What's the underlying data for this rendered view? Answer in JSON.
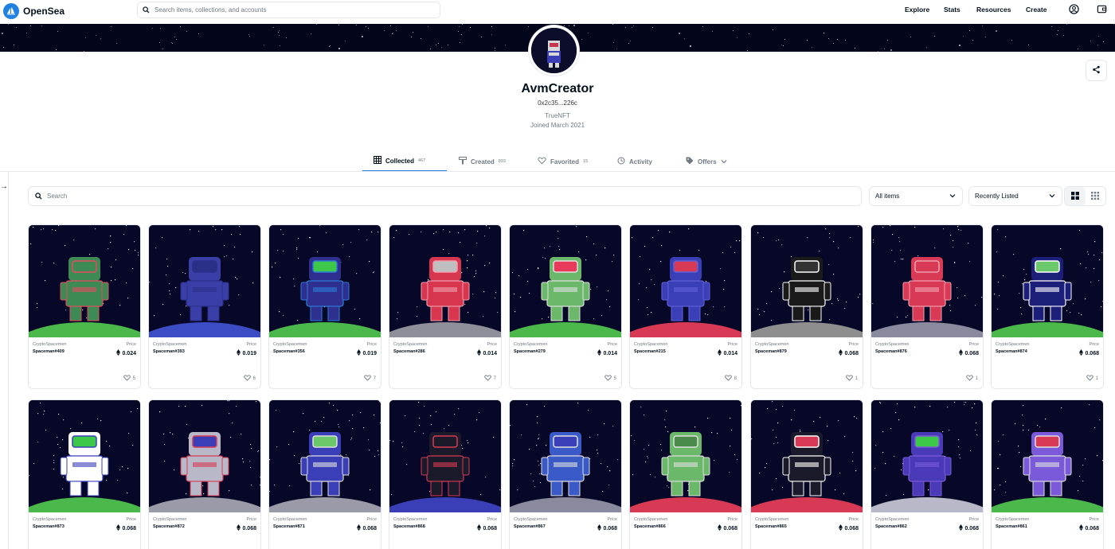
{
  "nav": {
    "brand": "OpenSea",
    "search_placeholder": "Search items, collections, and accounts",
    "links": [
      "Explore",
      "Stats",
      "Resources",
      "Create"
    ]
  },
  "profile": {
    "name": "AvmCreator",
    "address": "0x2c35...226c",
    "line1": "TrueNFT",
    "joined": "Joined March 2021"
  },
  "tabs": [
    {
      "label": "Collected",
      "count": "467"
    },
    {
      "label": "Created",
      "count": "893"
    },
    {
      "label": "Favorited",
      "count": "15"
    },
    {
      "label": "Activity",
      "count": ""
    },
    {
      "label": "Offers",
      "count": ""
    }
  ],
  "filters": {
    "search_placeholder": "Search",
    "items_select": "All items",
    "sort_select": "Recently Listed"
  },
  "price_label": "Price",
  "collection": "CryptoSpacemen",
  "cards": [
    {
      "name": "Spaceman#409",
      "price": "0.024",
      "likes": "5",
      "suit": "#3d8a55",
      "trim": "#e84a5f",
      "ground": "#4ab84a",
      "visor": "#3d8a55"
    },
    {
      "name": "Spaceman#393",
      "price": "0.019",
      "likes": "6",
      "suit": "#3a3fa8",
      "trim": "#2a2f88",
      "ground": "#3b4cc4",
      "visor": "#2a2f88"
    },
    {
      "name": "Spaceman#356",
      "price": "0.019",
      "likes": "7",
      "suit": "#2f2f8f",
      "trim": "#2b7dd8",
      "ground": "#4bb84b",
      "visor": "#3ec84a"
    },
    {
      "name": "Spaceman#286",
      "price": "0.014",
      "likes": "7",
      "suit": "#d8354f",
      "trim": "#f0a0b0",
      "ground": "#8f8f99",
      "visor": "#bfbfbf"
    },
    {
      "name": "Spaceman#279",
      "price": "0.014",
      "likes": "5",
      "suit": "#6bb86b",
      "trim": "#e0e0e0",
      "ground": "#4ab84a",
      "visor": "#e83a5a"
    },
    {
      "name": "Spaceman#215",
      "price": "0.014",
      "likes": "8",
      "suit": "#3a3fb8",
      "trim": "#6060d8",
      "ground": "#d83a55",
      "visor": "#d83a55"
    },
    {
      "name": "Spaceman#879",
      "price": "0.068",
      "likes": "1",
      "suit": "#1a1a1a",
      "trim": "#ffffff",
      "ground": "#8e8e8e",
      "visor": "#333333"
    },
    {
      "name": "Spaceman#876",
      "price": "0.068",
      "likes": "1",
      "suit": "#d83a55",
      "trim": "#f0a0b0",
      "ground": "#8a8a9e",
      "visor": "#d83a55"
    },
    {
      "name": "Spaceman#874",
      "price": "0.068",
      "likes": "1",
      "suit": "#1c1f7a",
      "trim": "#ffffff",
      "ground": "#4ab84a",
      "visor": "#6bc86b"
    },
    {
      "name": "Spaceman#873",
      "price": "0.068",
      "likes": "",
      "suit": "#ffffff",
      "trim": "#3a3fb8",
      "ground": "#4ab84a",
      "visor": "#3ec84a"
    },
    {
      "name": "Spaceman#872",
      "price": "0.068",
      "likes": "",
      "suit": "#b8b8c8",
      "trim": "#d83a55",
      "ground": "#9a9aa8",
      "visor": "#3a3fb8"
    },
    {
      "name": "Spaceman#871",
      "price": "0.068",
      "likes": "",
      "suit": "#3a3fb8",
      "trim": "#e0e0e0",
      "ground": "#9a9aa8",
      "visor": "#6bc86b"
    },
    {
      "name": "Spaceman#868",
      "price": "0.068",
      "likes": "",
      "suit": "#1a1a2a",
      "trim": "#d83a55",
      "ground": "#3a3fb8",
      "visor": "#1a1a2a"
    },
    {
      "name": "Spaceman#867",
      "price": "0.068",
      "likes": "",
      "suit": "#3a5ac8",
      "trim": "#e0e0e0",
      "ground": "#8a8a9e",
      "visor": "#3a3fb8"
    },
    {
      "name": "Spaceman#866",
      "price": "0.068",
      "likes": "",
      "suit": "#6bb86b",
      "trim": "#e0e0e0",
      "ground": "#d83a55",
      "visor": "#4a8a4a"
    },
    {
      "name": "Spaceman#865",
      "price": "0.068",
      "likes": "",
      "suit": "#1a1a2a",
      "trim": "#ffffff",
      "ground": "#d83a55",
      "visor": "#d83a55"
    },
    {
      "name": "Spaceman#862",
      "price": "0.068",
      "likes": "",
      "suit": "#4a3ab8",
      "trim": "#7a5ad8",
      "ground": "#b8b8c8",
      "visor": "#3ec84a"
    },
    {
      "name": "Spaceman#861",
      "price": "0.068",
      "likes": "",
      "suit": "#7a5ad8",
      "trim": "#e0e0e0",
      "ground": "#4ab84a",
      "visor": "#d83a55"
    }
  ]
}
